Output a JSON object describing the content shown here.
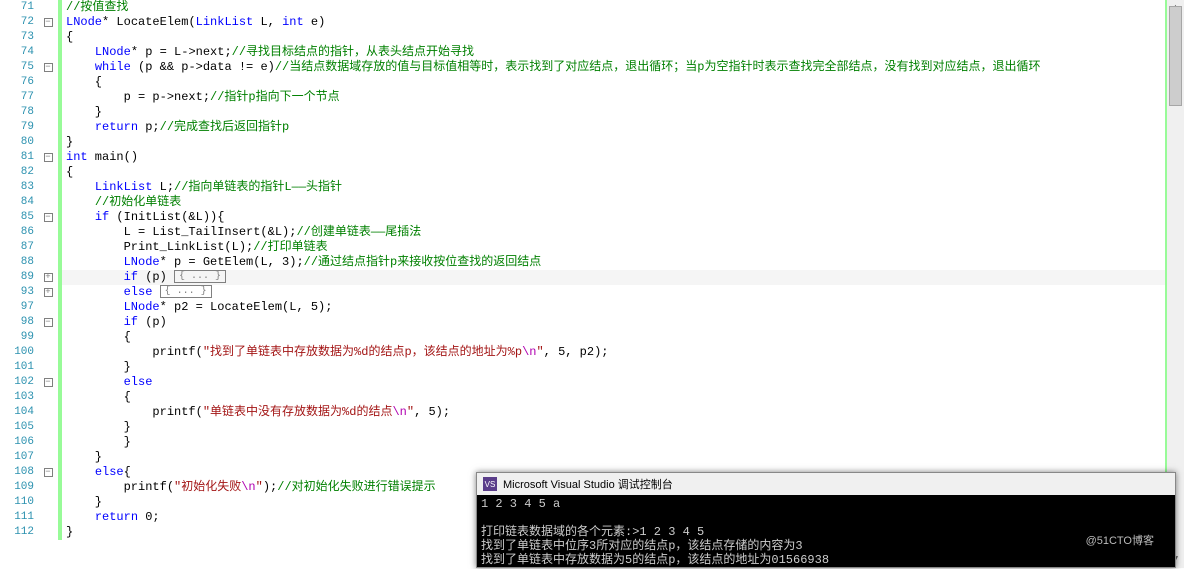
{
  "lineNumbers": [
    "71",
    "72",
    "73",
    "74",
    "75",
    "76",
    "77",
    "78",
    "79",
    "80",
    "81",
    "82",
    "83",
    "84",
    "85",
    "86",
    "87",
    "88",
    "89",
    "93",
    "97",
    "98",
    "99",
    "100",
    "101",
    "102",
    "103",
    "104",
    "105",
    "106",
    "107",
    "108",
    "109",
    "110",
    "111",
    "112"
  ],
  "fold": {
    "minus": "-",
    "plus": "+"
  },
  "tokens": {
    "cm71": "//按值查找",
    "type72": "LNode",
    "op72a": "* ",
    "fn72": "LocateElem",
    "p72a": "(",
    "t72b": "LinkList",
    "sp": " ",
    "id72": "L",
    "c72": ", ",
    "kw72": "int",
    "id72b": "e",
    "p72b": ")",
    "br73": "{",
    "t74": "LNode",
    "op74": "* ",
    "id74": "p = L->next;",
    "cm74": "//寻找目标结点的指针，从表头结点开始寻找",
    "kw75": "while",
    "expr75": " (p && p->data != e)",
    "cm75": "//当结点数据域存放的值与目标值相等时，表示找到了对应结点，退出循环；当p为空指针时表示查找完全部结点，没有找到对应结点，退出循环",
    "br76": "{",
    "stmt77": "p = p->next;",
    "cm77": "//指针p指向下一个节点",
    "br78": "}",
    "kw79": "return",
    "stmt79": " p;",
    "cm79": "//完成查找后返回指针p",
    "br80": "}",
    "kw81": "int",
    "fn81": " main()",
    "br82": "{",
    "t83": "LinkList",
    "id83": " L;",
    "cm83": "//指向单链表的指针L——头指针",
    "cm84": "//初始化单链表",
    "kw85": "if",
    "expr85": " (InitList(&L)){",
    "stmt86": "L = List_TailInsert(&L);",
    "cm86": "//创建单链表——尾插法",
    "stmt87": "Print_LinkList(L);",
    "cm87": "//打印单链表",
    "t88": "LNode",
    "op88": "* ",
    "stmt88": "p = GetElem(L, 3);",
    "cm88": "//通过结点指针p来接收按位查找的返回结点",
    "kw89": "if",
    "expr89": " (p)",
    "box89": "{ ... }",
    "kw93": "else",
    "box93": "{ ... }",
    "t97": "LNode",
    "op97": "* ",
    "stmt97": "p2 = LocateElem(L, 5);",
    "kw98": "if",
    "expr98": " (p)",
    "br99": "{",
    "fn100": "printf(",
    "str100a": "\"找到了单链表中存放数据为",
    "fmt100a": "%d",
    "str100b": "的结点p，该结点的地址为",
    "fmt100b": "%p",
    "esc100": "\\n",
    "str100c": "\"",
    "args100": ", 5, p2);",
    "br101": "}",
    "kw102": "else",
    "br103": "{",
    "fn104": "printf(",
    "str104a": "\"单链表中没有存放数据为",
    "fmt104": "%d",
    "str104b": "的结点",
    "esc104": "\\n",
    "str104c": "\"",
    "args104": ", 5);",
    "br105": "}",
    "br106": "}",
    "br107": "}",
    "kw108": "else",
    "br108": "{",
    "fn109": "printf(",
    "str109": "\"初始化失败",
    "esc109": "\\n",
    "str109b": "\"",
    ")": ");",
    "cm109": "//对初始化失败进行错误提示",
    "br110": "}",
    "kw111": "return",
    "stmt111": " 0;",
    "br112": "}"
  },
  "console": {
    "title": "Microsoft Visual Studio 调试控制台",
    "icon": "VS",
    "lines": [
      "1 2 3 4 5 a",
      "",
      "打印链表数据域的各个元素:>1 2 3 4 5",
      "找到了单链表中位序3所对应的结点p，该结点存储的内容为3",
      "找到了单链表中存放数据为5的结点p，该结点的地址为01566938"
    ]
  },
  "watermark": "@51CTO博客"
}
